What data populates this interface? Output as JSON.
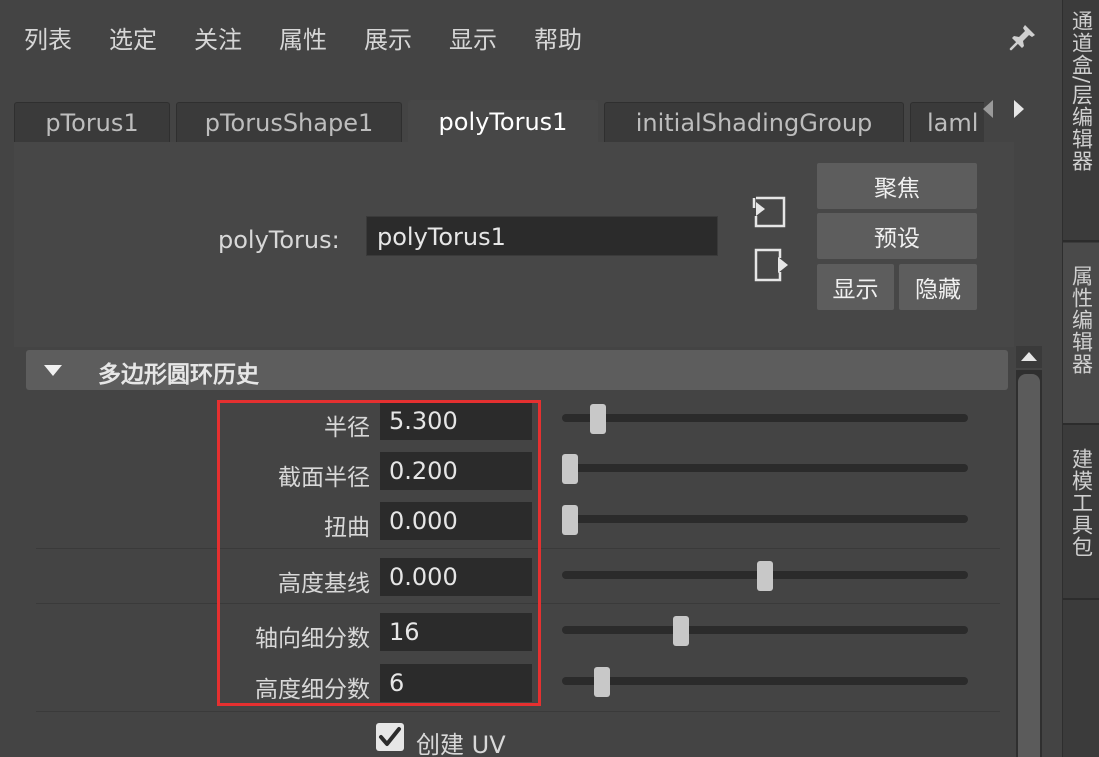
{
  "menu": [
    "列表",
    "选定",
    "关注",
    "属性",
    "展示",
    "显示",
    "帮助"
  ],
  "dock_tabs": [
    "通道盒/层编辑器",
    "属性编辑器",
    "建模工具包"
  ],
  "tabs": [
    "pTorus1",
    "pTorusShape1",
    "polyTorus1",
    "initialShadingGroup",
    "laml"
  ],
  "active_tab": "polyTorus1",
  "node": {
    "label": "polyTorus:",
    "value": "polyTorus1"
  },
  "buttons": {
    "focus": "聚焦",
    "preset": "预设",
    "show": "显示",
    "hide": "隐藏"
  },
  "section": {
    "title": "多边形圆环历史",
    "expanded": true
  },
  "attributes": [
    {
      "label": "半径",
      "value": "5.300",
      "slider": 0.08
    },
    {
      "label": "截面半径",
      "value": "0.200",
      "slider": 0.01
    },
    {
      "label": "扭曲",
      "value": "0.000",
      "slider": 0.01
    },
    {
      "label": "高度基线",
      "value": "0.000",
      "slider": 0.5
    },
    {
      "label": "轴向细分数",
      "value": "16",
      "slider": 0.29
    },
    {
      "label": "高度细分数",
      "value": "6",
      "slider": 0.09
    }
  ],
  "checkbox": {
    "label": "创建 UV",
    "checked": true
  },
  "colors": {
    "highlight": "#e53030",
    "background": "#444444",
    "field": "#2b2b2b"
  }
}
